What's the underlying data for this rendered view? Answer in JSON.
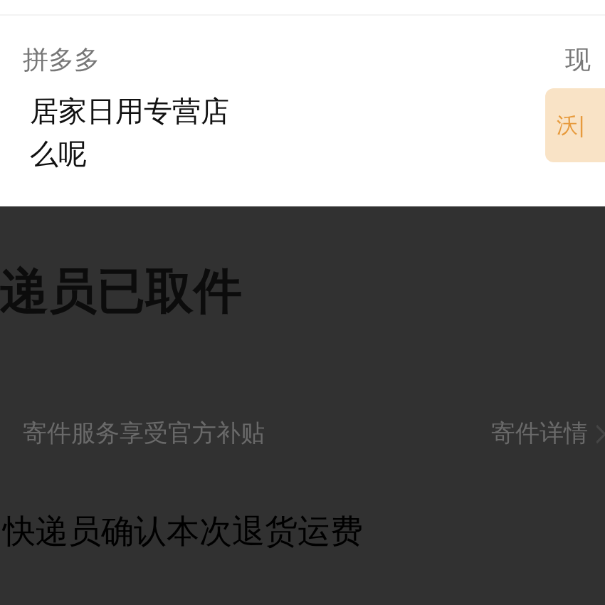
{
  "message": {
    "source": "拼多多",
    "time": "现",
    "shop": "居家日用专营店",
    "preview": "么呢",
    "thumbnail_text": "沃|"
  },
  "return_card": {
    "status": "递员已取件",
    "subsidy_note": "寄件服务享受官方补贴",
    "details_link": "寄件详情",
    "fee_note": "快递员确认本次退货运费"
  }
}
